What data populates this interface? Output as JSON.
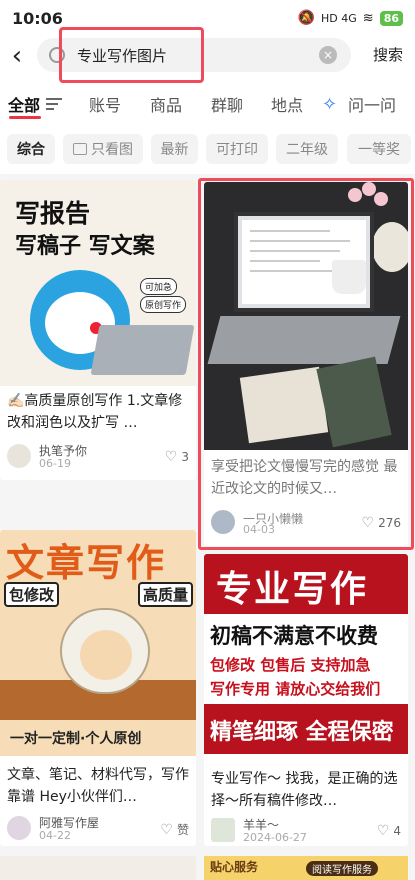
{
  "status_bar": {
    "time": "10:06",
    "battery": "86",
    "signal": "HD 4G"
  },
  "search": {
    "query": "专业写作图片",
    "button": "搜索"
  },
  "tabs": [
    {
      "label": "全部",
      "active": true
    },
    {
      "label": "账号"
    },
    {
      "label": "商品"
    },
    {
      "label": "群聊"
    },
    {
      "label": "地点"
    },
    {
      "label": "问一问"
    }
  ],
  "chips": [
    {
      "label": "综合",
      "active": true
    },
    {
      "label": "只看图"
    },
    {
      "label": "最新"
    },
    {
      "label": "可打印"
    },
    {
      "label": "二年级"
    },
    {
      "label": "一等奖"
    }
  ],
  "cards": [
    {
      "image_text": {
        "line1": "写报告",
        "line2": "写稿子 写文案",
        "badge1": "可加急",
        "badge2": "原创写作"
      },
      "title": "✍🏻高质量原创写作 1.文章修改和润色以及扩写 …",
      "author": "执笔予你",
      "date": "06-19",
      "likes": "3"
    },
    {
      "title": "享受把论文慢慢写完的感觉 最近改论文的时候又…",
      "author": "一只小懒懒",
      "date": "04-03",
      "likes": "276"
    },
    {
      "image_text": {
        "headline": "文章写作",
        "tag_left": "包修改",
        "tag_right": "高质量",
        "footer": "一对一定制·个人原创"
      },
      "title": "文章、笔记、材料代写，写作靠谱 Hey小伙伴们…",
      "author": "阿雅写作屋",
      "date": "04-22",
      "likes": "赞"
    },
    {
      "image_text": {
        "headline": "专业写作",
        "line2": "初稿不满意不收费",
        "line3": "包修改 包售后 支持加急",
        "line4": "写作专用 请放心交给我们",
        "footer": "精笔细琢 全程保密"
      },
      "title": "专业写作～ 找我，是正确的选择～所有稿件修改…",
      "author": "羊羊～",
      "date": "2024-06-27",
      "likes": "4"
    }
  ],
  "peek": {
    "right_label": "贴心服务",
    "right_button": "阅读写作服务"
  },
  "colors": {
    "accent": "#ee3344",
    "highlight": "#ee4c5a"
  }
}
